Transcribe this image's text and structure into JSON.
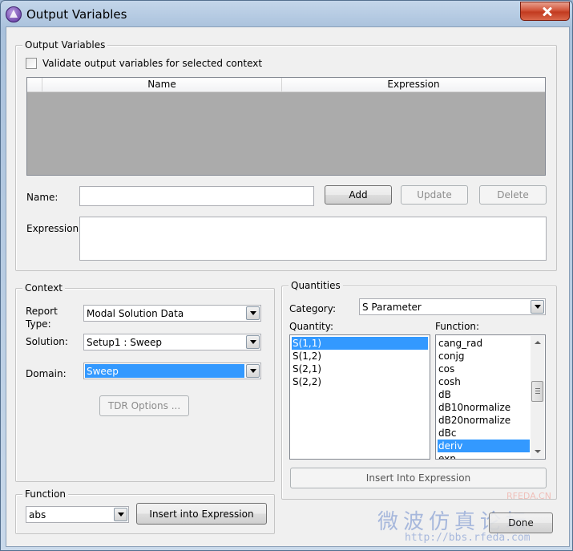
{
  "window": {
    "title": "Output Variables"
  },
  "output_variables": {
    "group_label": "Output Variables",
    "validate_label": "Validate output variables for selected context",
    "validate_checked": false,
    "grid_columns": [
      "Name",
      "Expression"
    ],
    "name_label": "Name:",
    "name_value": "",
    "expression_label": "Expression:",
    "expression_value": "",
    "add_label": "Add",
    "update_label": "Update",
    "delete_label": "Delete"
  },
  "context": {
    "group_label": "Context",
    "report_type_label": "Report\nType:",
    "report_type_line1": "Report",
    "report_type_line2": "Type:",
    "report_type_value": "Modal Solution Data",
    "solution_label": "Solution:",
    "solution_value": "Setup1 : Sweep",
    "domain_label": "Domain:",
    "domain_value": "Sweep",
    "tdr_label": "TDR Options ..."
  },
  "quantities": {
    "group_label": "Quantities",
    "category_label": "Category:",
    "category_value": "S Parameter",
    "quantity_label": "Quantity:",
    "function_label": "Function:",
    "quantity_items": [
      "S(1,1)",
      "S(1,2)",
      "S(2,1)",
      "S(2,2)"
    ],
    "quantity_selected_index": 0,
    "function_items": [
      "cang_rad",
      "conjg",
      "cos",
      "cosh",
      "dB",
      "dB10normalize",
      "dB20normalize",
      "dBc",
      "deriv",
      "exp"
    ],
    "function_selected_index": 8,
    "insert_label": "Insert Into Expression"
  },
  "function": {
    "group_label": "Function",
    "value": "abs",
    "insert_label": "Insert into Expression"
  },
  "footer": {
    "done_label": "Done"
  },
  "watermark": {
    "brand": "RFEDA.CN",
    "chinese": "微波仿真论坛",
    "url": "http://bbs.rfeda.com"
  },
  "colors": {
    "selection": "#3399ff",
    "grid_background": "#ababab",
    "close_button": "#c23a1f"
  }
}
